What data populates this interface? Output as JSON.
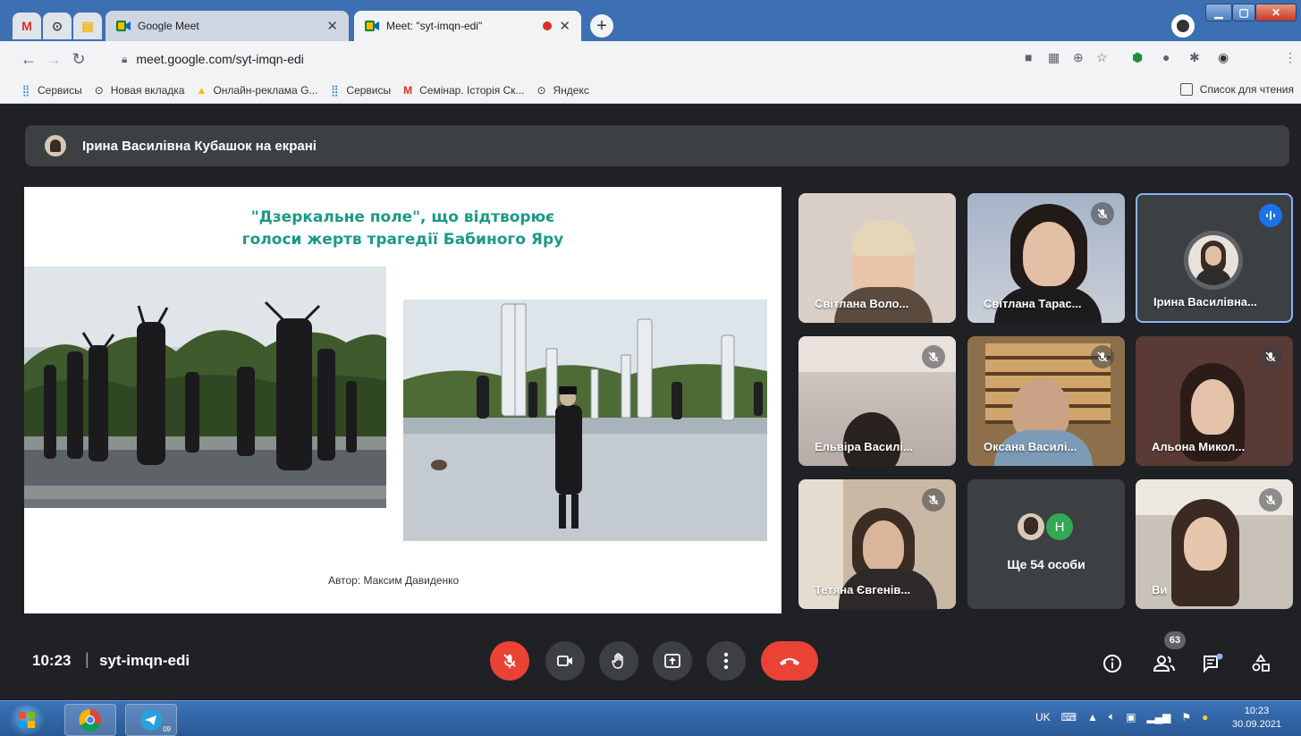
{
  "browser": {
    "tabs": [
      {
        "label": "Google Meet",
        "favicon": "meet-icon",
        "active": false
      },
      {
        "label": "Meet: \"syt-imqn-edi\"",
        "favicon": "meet-icon",
        "active": true,
        "recording": true
      }
    ],
    "mini_tabs": [
      "gmail-icon",
      "chrome-icon",
      "docs-icon"
    ],
    "url": "meet.google.com/syt-imqn-edi",
    "bookmarks": [
      {
        "label": "Сервисы",
        "icon": "apps-icon"
      },
      {
        "label": "Новая вкладка",
        "icon": "globe-icon"
      },
      {
        "label": "Онлайн-реклама G...",
        "icon": "ads-icon"
      },
      {
        "label": "Сервисы",
        "icon": "apps-icon"
      },
      {
        "label": "Семінар. Історія Ск...",
        "icon": "gmail-icon"
      },
      {
        "label": "Яндекс",
        "icon": "globe-icon"
      }
    ],
    "reading_list": "Список для чтения"
  },
  "meet": {
    "presenter_banner": "Ірина Василівна Кубашок на екрані",
    "slide": {
      "title_line1": "\"Дзеркальне поле\", що відтворює",
      "title_line2": "голоси жертв трагедії Бабиного Яру",
      "author": "Автор: Максим Давиденко"
    },
    "participants": [
      {
        "name": "Світлана Воло...",
        "muted": false
      },
      {
        "name": "Світлана Тарас...",
        "muted": true
      },
      {
        "name": "Ірина Василівна...",
        "muted": false,
        "speaking": true
      },
      {
        "name": "Ельвіра Василі...",
        "muted": true
      },
      {
        "name": "Оксана Василі...",
        "muted": true
      },
      {
        "name": "Альона Микол...",
        "muted": true
      },
      {
        "name": "Тетяна Євгенів...",
        "muted": true
      },
      {
        "name": "Ще 54 особи",
        "avatar_letter": "Н"
      },
      {
        "name": "Ви",
        "muted": true
      }
    ],
    "time": "10:23",
    "separator": "|",
    "meeting_code": "syt-imqn-edi",
    "people_count": "63"
  },
  "taskbar": {
    "language": "UK",
    "time": "10:23",
    "date": "30.09.2021",
    "telegram_badge": "09"
  }
}
